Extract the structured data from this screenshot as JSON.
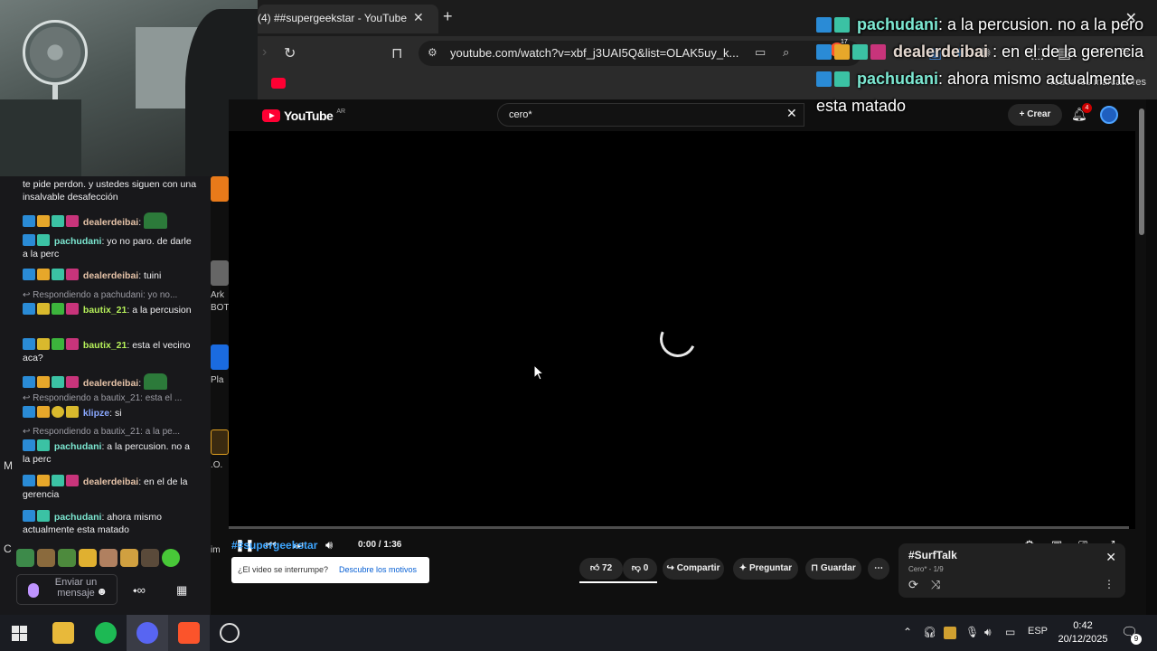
{
  "browser": {
    "tab_title": "(4) ##supergeekstar - YouTube",
    "url": "youtube.com/watch?v=xbf_j3UAI5Q&list=OLAK5uy_k...",
    "bookmarks_label": "Todos los marcadores",
    "extension_badge": "17"
  },
  "youtube": {
    "search_query": "cero*",
    "create_label": "Crear",
    "notifications_count": "4",
    "time": "0:00 / 1:36",
    "video_title": "##supergeekstar",
    "interrupt_question": "¿El video se interrumpe?",
    "interrupt_link": "Descubre los motivos",
    "likes": "72",
    "dislikes": "0",
    "share_label": "Compartir",
    "ask_label": "Preguntar",
    "save_label": "Guardar",
    "playlist": {
      "title": "#SurfTalk",
      "subtitle": "Cero* - 1/9"
    }
  },
  "chat": {
    "messages": [
      {
        "text": "te pide perdon. y ustedes siguen con una insalvable desafección"
      },
      {
        "user": "dealerdeibai",
        "text": ":"
      },
      {
        "user": "pachudani",
        "text": ": yo no paro. de darle a la perc"
      },
      {
        "user": "dealerdeibai",
        "text": ": tuini"
      },
      {
        "reply": "Respondiendo a pachudani: yo no..."
      },
      {
        "user": "bautix_21",
        "text": ": a la percusion"
      },
      {
        "user": "bautix_21",
        "text": ": esta el vecino aca?"
      },
      {
        "user": "dealerdeibai",
        "text": ":"
      },
      {
        "reply": "Respondiendo a bautix_21: esta el ..."
      },
      {
        "user": "klipze",
        "text": ": si"
      },
      {
        "reply": "Respondiendo a bautix_21: a la pe..."
      },
      {
        "user": "pachudani",
        "text": ": a la percusion. no a la perc"
      },
      {
        "user": "dealerdeibai",
        "text": ": en el de la gerencia"
      },
      {
        "user": "pachudani",
        "text": ": ahora mismo actualmente esta matado"
      }
    ],
    "input_placeholder": "Enviar un mensaje",
    "user_colors": {
      "dealerdeibai": "#e6c3a8",
      "pachudani": "#7ce8d2",
      "bautix_21": "#b6f05a",
      "klipze": "#8aa8ff"
    }
  },
  "overlay": {
    "messages": [
      {
        "user": "pachudani",
        "text": ": a la percusion. no a la pero"
      },
      {
        "user": "dealerdeibai",
        "text": " : en el de la gerencia"
      },
      {
        "user": "pachudani",
        "text": ": ahora mismo actualmente esta matado"
      }
    ]
  },
  "strip": {
    "labels": [
      "Ark",
      "BOT",
      "Pla",
      ".O.",
      "im",
      "M",
      "C"
    ]
  },
  "taskbar": {
    "language": "ESP",
    "time": "0:42",
    "date": "20/12/2025",
    "notification_count": "9"
  }
}
